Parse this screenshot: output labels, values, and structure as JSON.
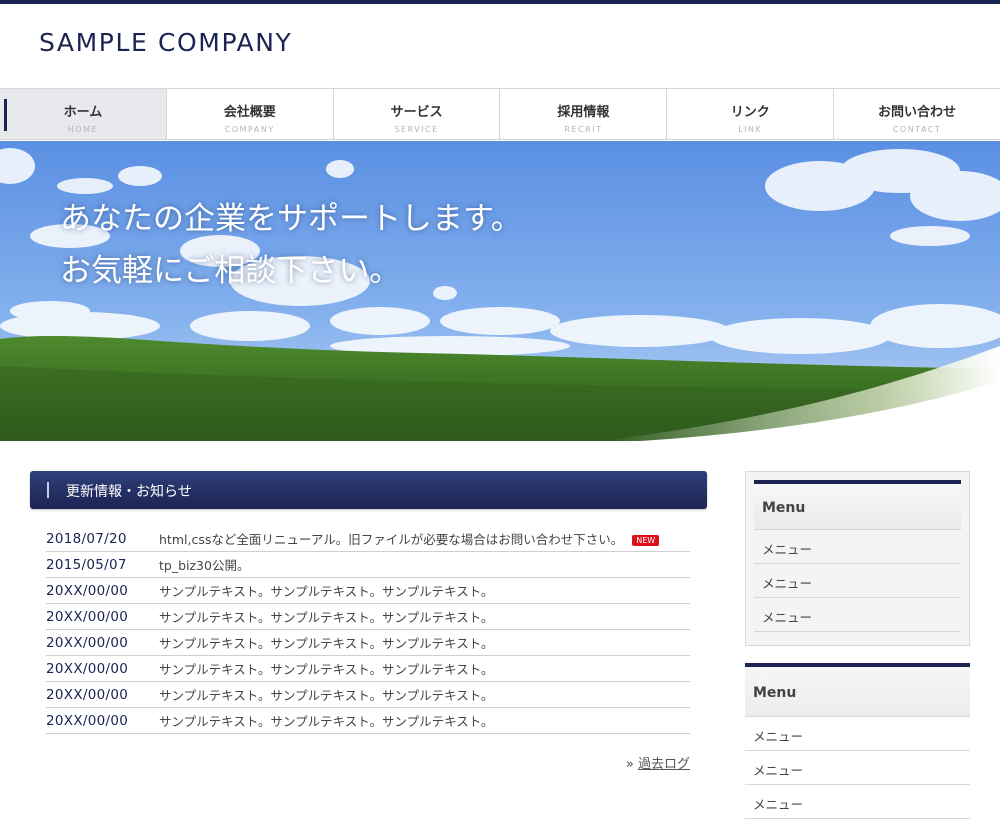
{
  "site": {
    "logo": "SAMPLE COMPANY"
  },
  "nav": [
    {
      "label": "ホーム",
      "sub": "HOME",
      "active": true
    },
    {
      "label": "会社概要",
      "sub": "COMPANY"
    },
    {
      "label": "サービス",
      "sub": "SERVICE"
    },
    {
      "label": "採用情報",
      "sub": "RECRIT"
    },
    {
      "label": "リンク",
      "sub": "LINK"
    },
    {
      "label": "お問い合わせ",
      "sub": "CONTACT"
    }
  ],
  "hero": {
    "line1": "あなたの企業をサポートします。",
    "line2": "お気軽にご相談下さい。"
  },
  "news": {
    "title": "更新情報・お知らせ",
    "badge": "NEW",
    "items": [
      {
        "date": "2018/07/20",
        "text": "html,cssなど全面リニューアル。旧ファイルが必要な場合はお問い合わせ下さい。"
      },
      {
        "date": "2015/05/07",
        "text": "tp_biz30公開。"
      },
      {
        "date": "20XX/00/00",
        "text": "サンプルテキスト。サンプルテキスト。サンプルテキスト。"
      },
      {
        "date": "20XX/00/00",
        "text": "サンプルテキスト。サンプルテキスト。サンプルテキスト。"
      },
      {
        "date": "20XX/00/00",
        "text": "サンプルテキスト。サンプルテキスト。サンプルテキスト。"
      },
      {
        "date": "20XX/00/00",
        "text": "サンプルテキスト。サンプルテキスト。サンプルテキスト。"
      },
      {
        "date": "20XX/00/00",
        "text": "サンプルテキスト。サンプルテキスト。サンプルテキスト。"
      },
      {
        "date": "20XX/00/00",
        "text": "サンプルテキスト。サンプルテキスト。サンプルテキスト。"
      }
    ],
    "archive_prefix": "»",
    "archive_label": "過去ログ"
  },
  "sidebar": {
    "box1": {
      "title": "Menu",
      "items": [
        "メニュー",
        "メニュー",
        "メニュー"
      ]
    },
    "box2": {
      "title": "Menu",
      "items": [
        "メニュー",
        "メニュー",
        "メニュー"
      ]
    }
  },
  "colors": {
    "brand": "#1b2352",
    "badge": "#e0101a"
  }
}
